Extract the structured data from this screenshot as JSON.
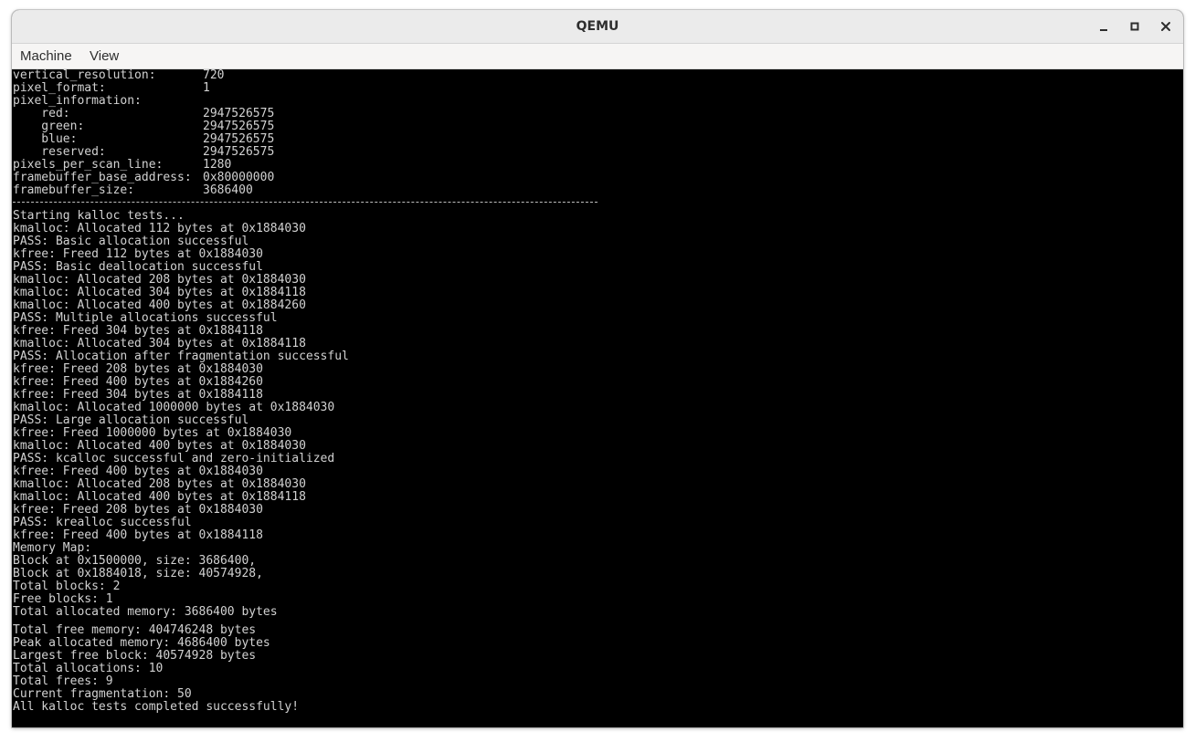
{
  "window": {
    "title": "QEMU"
  },
  "menubar": {
    "items": [
      "Machine",
      "View"
    ]
  },
  "console": {
    "info": [
      {
        "label": "vertical_resolution:",
        "value": "720"
      },
      {
        "label": "pixel_format:",
        "value": "1"
      },
      {
        "label": "pixel_information:",
        "value": ""
      },
      {
        "label": "    red:",
        "value": "2947526575"
      },
      {
        "label": "    green:",
        "value": "2947526575"
      },
      {
        "label": "    blue:",
        "value": "2947526575"
      },
      {
        "label": "    reserved:",
        "value": "2947526575"
      },
      {
        "label": "pixels_per_scan_line:",
        "value": "1280"
      },
      {
        "label": "framebuffer_base_address:",
        "value": "0x80000000"
      },
      {
        "label": "framebuffer_size:",
        "value": "3686400"
      }
    ],
    "log": [
      "Starting kalloc tests...",
      "kmalloc: Allocated 112 bytes at 0x1884030",
      "PASS: Basic allocation successful",
      "kfree: Freed 112 bytes at 0x1884030",
      "PASS: Basic deallocation successful",
      "kmalloc: Allocated 208 bytes at 0x1884030",
      "kmalloc: Allocated 304 bytes at 0x1884118",
      "kmalloc: Allocated 400 bytes at 0x1884260",
      "PASS: Multiple allocations successful",
      "kfree: Freed 304 bytes at 0x1884118",
      "kmalloc: Allocated 304 bytes at 0x1884118",
      "PASS: Allocation after fragmentation successful",
      "kfree: Freed 208 bytes at 0x1884030",
      "kfree: Freed 400 bytes at 0x1884260",
      "kfree: Freed 304 bytes at 0x1884118",
      "kmalloc: Allocated 1000000 bytes at 0x1884030",
      "PASS: Large allocation successful",
      "kfree: Freed 1000000 bytes at 0x1884030",
      "kmalloc: Allocated 400 bytes at 0x1884030",
      "PASS: kcalloc successful and zero-initialized",
      "kfree: Freed 400 bytes at 0x1884030",
      "kmalloc: Allocated 208 bytes at 0x1884030",
      "kmalloc: Allocated 400 bytes at 0x1884118",
      "kfree: Freed 208 bytes at 0x1884030",
      "PASS: krealloc successful",
      "kfree: Freed 400 bytes at 0x1884118",
      "Memory Map:",
      "Block at 0x1500000, size: 3686400,",
      "Block at 0x1884018, size: 40574928,",
      "Total blocks: 2",
      "Free blocks: 1",
      "Total allocated memory: 3686400 bytes"
    ],
    "stats": [
      "Total free memory: 404746248 bytes",
      "Peak allocated memory: 4686400 bytes",
      "Largest free block: 40574928 bytes",
      "Total allocations: 10",
      "Total frees: 9",
      "Current fragmentation: 50",
      "All kalloc tests completed successfully!"
    ]
  }
}
